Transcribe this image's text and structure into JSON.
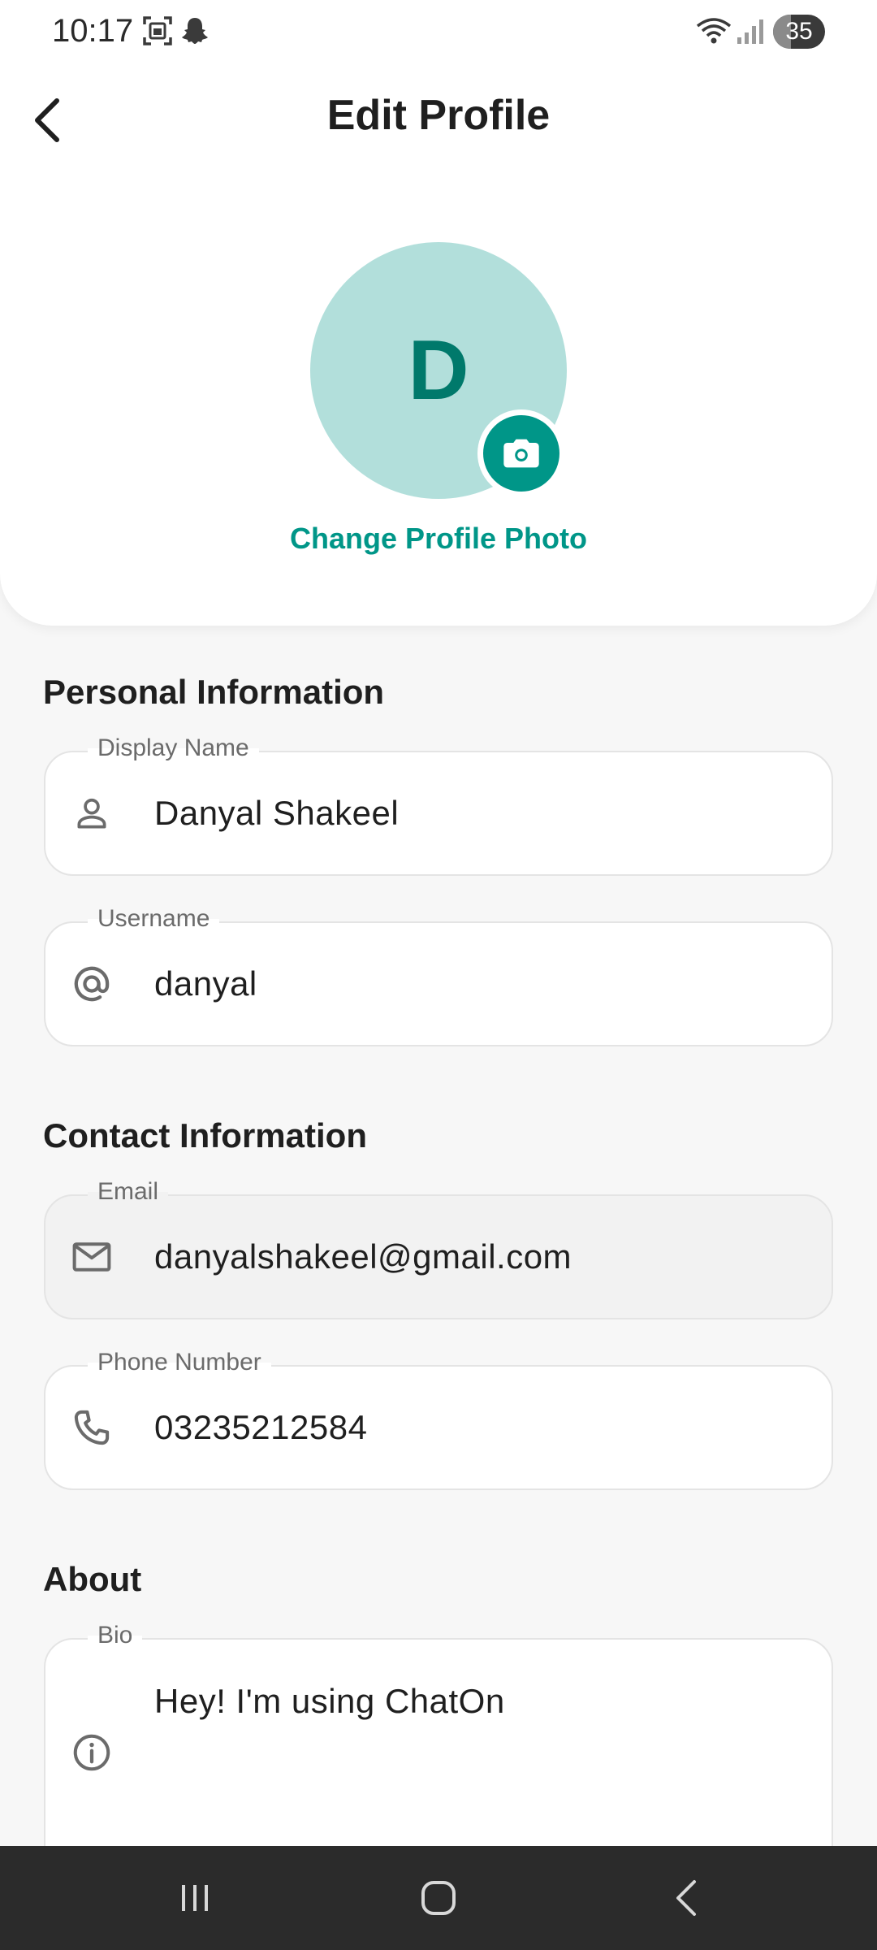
{
  "status_bar": {
    "time": "10:17",
    "battery_level": "35",
    "icons": [
      "screenshot-icon",
      "snapchat-icon",
      "wifi-icon",
      "signal-icon",
      "battery-icon"
    ]
  },
  "header": {
    "title": "Edit Profile",
    "back_icon": "chevron-left-icon"
  },
  "profile": {
    "avatar_initial": "D",
    "change_photo_label": "Change Profile Photo",
    "camera_icon": "camera-icon"
  },
  "colors": {
    "accent": "#009688",
    "avatar_bg": "#b2dfdb",
    "avatar_text": "#00796b"
  },
  "personal": {
    "heading": "Personal Information",
    "display_name": {
      "label": "Display Name",
      "value": "Danyal Shakeel",
      "icon": "person-icon"
    },
    "username": {
      "label": "Username",
      "value": "danyal",
      "icon": "at-icon"
    }
  },
  "contact": {
    "heading": "Contact Information",
    "email": {
      "label": "Email",
      "value": "danyalshakeel@gmail.com",
      "icon": "mail-icon"
    },
    "phone": {
      "label": "Phone Number",
      "value": "03235212584",
      "icon": "phone-icon"
    }
  },
  "about": {
    "heading": "About",
    "bio": {
      "label": "Bio",
      "value": "Hey! I'm using ChatOn",
      "icon": "info-icon"
    }
  },
  "nav_bar": {
    "buttons": [
      "recents-icon",
      "home-icon",
      "back-icon"
    ]
  }
}
